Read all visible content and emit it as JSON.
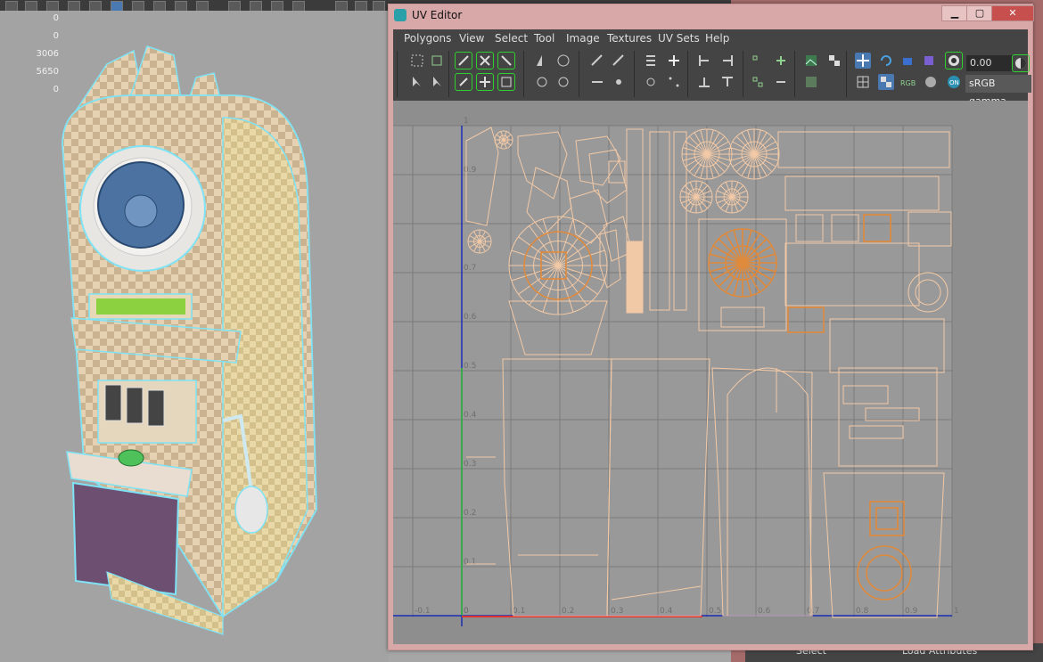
{
  "viewport": {
    "hud_values": [
      "0",
      "0",
      "3006",
      "5650",
      "0"
    ]
  },
  "window": {
    "title": "UV Editor",
    "min": "▁",
    "max": "▢",
    "close": "✕"
  },
  "menu": [
    "Polygons",
    "View",
    "Select",
    "Tool",
    "Image",
    "Textures",
    "UV Sets",
    "Help"
  ],
  "toolbar": {
    "exposure_value": "0.00",
    "colorspace": "sRGB gamma"
  },
  "axis": {
    "v_ticks": [
      "1",
      "0.9",
      "0.7",
      "0.6",
      "0.5",
      "0.4",
      "0.3",
      "0.2",
      "0.1",
      "0"
    ],
    "u_ticks": [
      "-0.1",
      "0",
      "0.1",
      "0.2",
      "0.3",
      "0.4",
      "0.5",
      "0.6",
      "0.7",
      "0.8",
      "0.9",
      "1"
    ]
  },
  "backdrop": {
    "label_left": "Select",
    "label_right": "Load Attributes"
  },
  "colors": {
    "uv_shell": "#f2c9a6",
    "uv_selected": "#e08a3c",
    "grid": "#7a7a7a",
    "u_axis": "#d33",
    "v_axis": "#2fbf2f",
    "bounds": "#1c2fb5"
  }
}
